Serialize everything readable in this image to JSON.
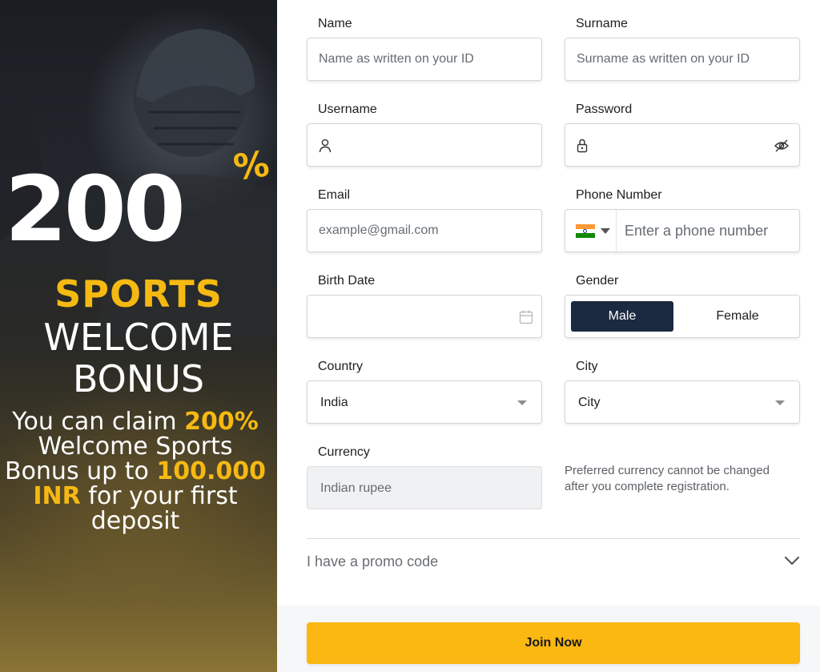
{
  "banner": {
    "big_number": "200",
    "percent_sign": "%",
    "sports": "SPORTS",
    "welcome": "WELCOME",
    "bonus": "BONUS",
    "text_part1": "You can claim ",
    "text_highlight1": "200%",
    "text_part2": " Welcome Sports Bonus up to ",
    "text_highlight2": "100.000 INR",
    "text_part3": " for your first deposit",
    "accent_color": "#f5b912"
  },
  "form": {
    "name": {
      "label": "Name",
      "placeholder": "Name as written on your ID"
    },
    "surname": {
      "label": "Surname",
      "placeholder": "Surname as written on your ID"
    },
    "username": {
      "label": "Username",
      "icon": "user-icon"
    },
    "password": {
      "label": "Password",
      "icon": "lock-icon",
      "toggle_icon": "eye-off-icon"
    },
    "email": {
      "label": "Email",
      "placeholder": "example@gmail.com"
    },
    "phone": {
      "label": "Phone Number",
      "placeholder": "Enter a phone number",
      "country_flag": "india-flag"
    },
    "birth_date": {
      "label": "Birth Date",
      "icon": "calendar-icon"
    },
    "gender": {
      "label": "Gender",
      "options": [
        "Male",
        "Female"
      ],
      "selected": "Male"
    },
    "country": {
      "label": "Country",
      "value": "India"
    },
    "city": {
      "label": "City",
      "value": "City"
    },
    "currency": {
      "label": "Currency",
      "value": "Indian rupee",
      "note": "Preferred currency cannot be changed after you complete registration."
    },
    "promo": {
      "label": "I have a promo code",
      "icon": "chevron-down-icon"
    },
    "submit": {
      "label": "Join Now",
      "color": "#fbb712"
    },
    "selected_color": "#1b2a41"
  }
}
